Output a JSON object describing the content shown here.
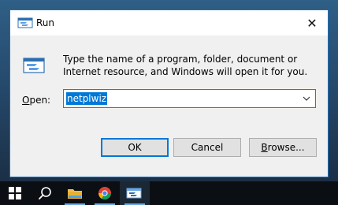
{
  "dialog": {
    "title": "Run",
    "instructions": "Type the name of a program, folder, document or Internet resource, and Windows will open it for you.",
    "open_label_prefix": "O",
    "open_label_rest": "pen:",
    "open_value": "netplwiz",
    "buttons": {
      "ok": "OK",
      "cancel": "Cancel",
      "browse_prefix": "B",
      "browse_rest": "rowse..."
    }
  },
  "taskbar": {
    "items": [
      "windows-start",
      "search",
      "file-explorer",
      "chrome",
      "run"
    ]
  },
  "colors": {
    "accent": "#0078d7",
    "window_bg": "#f0f0f0",
    "taskbar_bg": "#0b0f14"
  }
}
